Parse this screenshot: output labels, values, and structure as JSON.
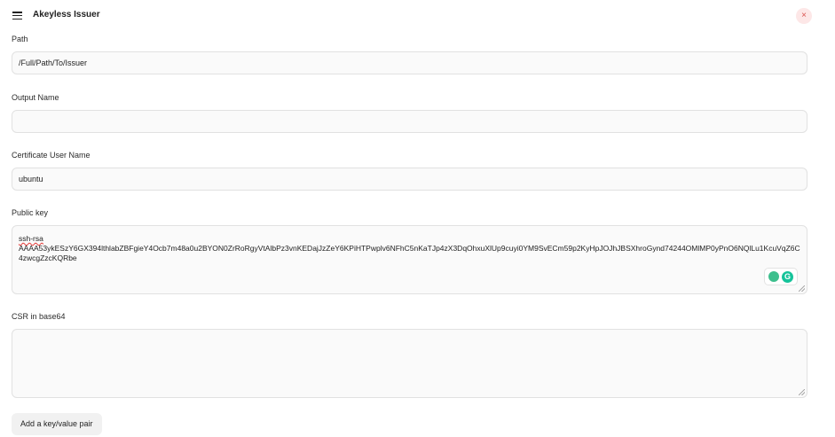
{
  "header": {
    "title": "Akeyless Issuer",
    "close_glyph": "×"
  },
  "fields": {
    "path": {
      "label": "Path",
      "value": "/Full/Path/To/Issuer"
    },
    "output_name": {
      "label": "Output Name",
      "value": ""
    },
    "cert_user": {
      "label": "Certificate User Name",
      "value": "ubuntu"
    },
    "public_key": {
      "label": "Public key",
      "line1": "ssh-rsa",
      "line2": "AAAA53ykESzY6GX394lthlabZBFgieY4Ocb7m48a0u2BYON0ZrRoRgyVtAlbPz3vnKEDajJzZeY6KPiHTPwplv6NFhC5nKaTJp4zX3DqOhxuXlUp9cuyi0YM9SvECm59p2KyHpJOJhJBSXhroGynd74244OMlMP0yPnO6NQlLu1KcuVqZ6C4zwcgZzcKQRbe"
    },
    "csr": {
      "label": "CSR in base64",
      "value": ""
    }
  },
  "actions": {
    "add_pair_label": "Add a key/value pair"
  },
  "icons": {
    "menu": "hamburger-icon",
    "close": "close-icon",
    "grammarly": "grammarly-icon"
  },
  "colors": {
    "close_bg": "#fde7e7",
    "close_fg": "#d9534f",
    "grammarly": "#15c39a"
  }
}
